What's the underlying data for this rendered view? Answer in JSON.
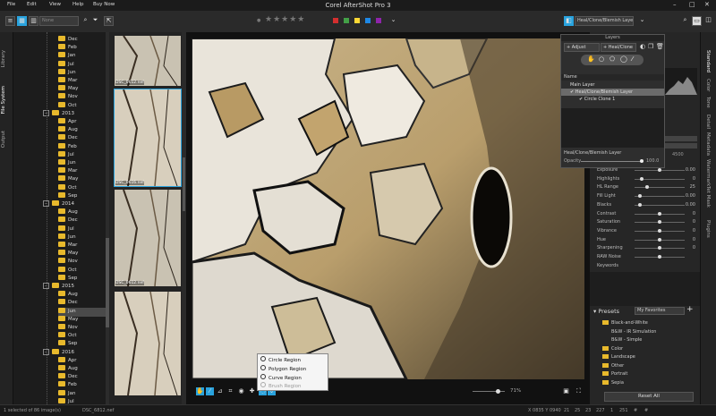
{
  "app": {
    "title": "Corel AfterShot Pro 3",
    "menu": [
      "File",
      "Edit",
      "View",
      "Help",
      "Buy Now"
    ],
    "window_controls": [
      "–",
      "□",
      "✕"
    ]
  },
  "toolbar": {
    "search_value": "None",
    "stars": "★★★★★",
    "color_labels": [
      "#d32f2f",
      "#43a047",
      "#fdd835",
      "#1e88e5",
      "#8e24aa"
    ],
    "layer_select": "Heal/Clone/Blemish Layer",
    "accent": "#29a3de"
  },
  "left_tabs": [
    "Library",
    "File System",
    "Output"
  ],
  "tree": [
    {
      "label": "Dec",
      "type": "folder"
    },
    {
      "label": "Feb",
      "type": "folder"
    },
    {
      "label": "Jan",
      "type": "folder"
    },
    {
      "label": "Jul",
      "type": "folder"
    },
    {
      "label": "Jun",
      "type": "folder"
    },
    {
      "label": "Mar",
      "type": "folder"
    },
    {
      "label": "May",
      "type": "folder"
    },
    {
      "label": "Nov",
      "type": "folder"
    },
    {
      "label": "Oct",
      "type": "folder"
    },
    {
      "label": "2013",
      "type": "year"
    },
    {
      "label": "Apr",
      "type": "folder"
    },
    {
      "label": "Aug",
      "type": "folder"
    },
    {
      "label": "Dec",
      "type": "folder"
    },
    {
      "label": "Feb",
      "type": "folder"
    },
    {
      "label": "Jul",
      "type": "folder"
    },
    {
      "label": "Jun",
      "type": "folder"
    },
    {
      "label": "Mar",
      "type": "folder"
    },
    {
      "label": "May",
      "type": "folder"
    },
    {
      "label": "Oct",
      "type": "folder"
    },
    {
      "label": "Sep",
      "type": "folder"
    },
    {
      "label": "2014",
      "type": "year"
    },
    {
      "label": "Aug",
      "type": "folder"
    },
    {
      "label": "Dec",
      "type": "folder"
    },
    {
      "label": "Jul",
      "type": "folder"
    },
    {
      "label": "Jun",
      "type": "folder"
    },
    {
      "label": "Mar",
      "type": "folder"
    },
    {
      "label": "May",
      "type": "folder"
    },
    {
      "label": "Nov",
      "type": "folder"
    },
    {
      "label": "Oct",
      "type": "folder"
    },
    {
      "label": "Sep",
      "type": "folder"
    },
    {
      "label": "2015",
      "type": "year"
    },
    {
      "label": "Aug",
      "type": "folder"
    },
    {
      "label": "Dec",
      "type": "folder"
    },
    {
      "label": "Jun",
      "type": "folder",
      "selected": true
    },
    {
      "label": "May",
      "type": "folder"
    },
    {
      "label": "Nov",
      "type": "folder"
    },
    {
      "label": "Oct",
      "type": "folder"
    },
    {
      "label": "Sep",
      "type": "folder"
    },
    {
      "label": "2016",
      "type": "year"
    },
    {
      "label": "Apr",
      "type": "folder"
    },
    {
      "label": "Aug",
      "type": "folder"
    },
    {
      "label": "Dec",
      "type": "folder"
    },
    {
      "label": "Feb",
      "type": "folder"
    },
    {
      "label": "Jan",
      "type": "folder"
    },
    {
      "label": "Jul",
      "type": "folder"
    },
    {
      "label": "Jun",
      "type": "folder"
    }
  ],
  "thumbnails": [
    {
      "label": "DSC_0612.nef"
    },
    {
      "label": "DSC_0616.nef",
      "selected": true
    },
    {
      "label": "DSC_0612.nef"
    },
    {
      "label": ""
    }
  ],
  "layers_panel": {
    "title": "Layers",
    "add_adjust": "Adjust",
    "add_heal": "Heal/Clone",
    "name_header": "Name",
    "items": [
      {
        "label": "Main Layer",
        "checked": false
      },
      {
        "label": "Heal/Clone/Blemish Layer",
        "checked": true
      },
      {
        "label": "Circle Clone 1",
        "checked": true
      }
    ],
    "footer_label": "Heal/Clone/Blemish Layer",
    "opacity_label": "Opacity",
    "opacity_value": "100.0"
  },
  "adjust": {
    "sliders": [
      {
        "label": "Exposure",
        "value": "0.00",
        "pos": 0.5
      },
      {
        "label": "Highlights",
        "value": "0",
        "pos": 0.15
      },
      {
        "label": "HL Range",
        "value": "25",
        "pos": 0.25
      },
      {
        "label": "Fill Light",
        "value": "0.00",
        "pos": 0.1
      },
      {
        "label": "Blacks",
        "value": "0.00",
        "pos": 0.1
      },
      {
        "label": "Contrast",
        "value": "0",
        "pos": 0.5
      },
      {
        "label": "Saturation",
        "value": "0",
        "pos": 0.5
      },
      {
        "label": "Vibrance",
        "value": "0",
        "pos": 0.5
      },
      {
        "label": "Hue",
        "value": "0",
        "pos": 0.5
      },
      {
        "label": "Sharpening",
        "value": "0",
        "pos": 0.5
      },
      {
        "label": "RAW Noise",
        "value": "",
        "pos": 0.5
      }
    ],
    "keywords_label": "Keywords"
  },
  "presets": {
    "title": "Presets",
    "filter": "My Favorites",
    "items": [
      {
        "label": "Black-and-White",
        "indent": 0
      },
      {
        "label": "B&W - IR Simulation",
        "indent": 1
      },
      {
        "label": "B&W - Simple",
        "indent": 1
      },
      {
        "label": "Color",
        "indent": 0
      },
      {
        "label": "Landscape",
        "indent": 0
      },
      {
        "label": "Other",
        "indent": 0
      },
      {
        "label": "Portrait",
        "indent": 0
      },
      {
        "label": "Sepia",
        "indent": 0
      }
    ],
    "reset_label": "Reset All"
  },
  "right_tabs": [
    "Standard",
    "Color",
    "Tone",
    "Detail",
    "Metadata",
    "Watermark",
    "Tet Mask",
    "Plugins"
  ],
  "popup_menu": [
    {
      "label": "Circle Region",
      "enabled": true
    },
    {
      "label": "Polygon Region",
      "enabled": true
    },
    {
      "label": "Curve Region",
      "enabled": true
    },
    {
      "label": "Brush Region",
      "enabled": false
    }
  ],
  "zoom": "71%",
  "status": {
    "selection": "1 selected of 86 image(s)",
    "filename": "DSC_6812.nef",
    "coords": "X 0835  Y 0940",
    "readout_values": [
      "21",
      "25",
      "23",
      "227",
      "1",
      "251",
      "#",
      "#"
    ]
  }
}
